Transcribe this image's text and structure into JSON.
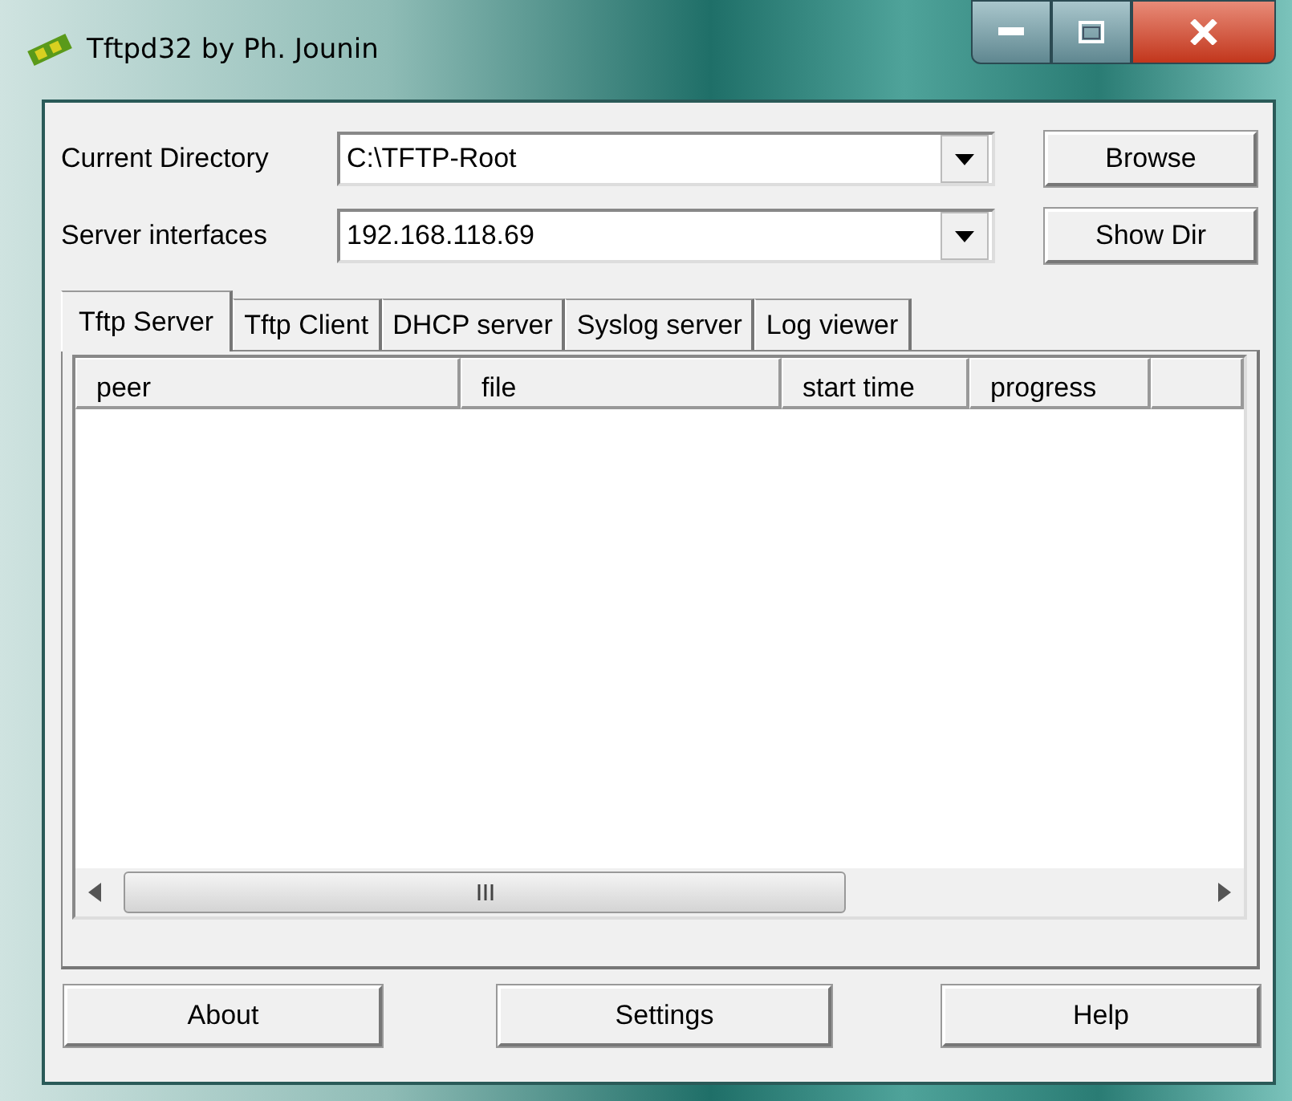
{
  "window": {
    "title": "Tftpd32 by Ph. Jounin"
  },
  "fields": [
    {
      "label": "Current Directory",
      "value": "C:\\TFTP-Root",
      "button": "Browse"
    },
    {
      "label": "Server interfaces",
      "value": "192.168.118.69",
      "button": "Show Dir"
    }
  ],
  "tabs": [
    {
      "label": "Tftp Server",
      "selected": true
    },
    {
      "label": "Tftp Client",
      "selected": false
    },
    {
      "label": "DHCP server",
      "selected": false
    },
    {
      "label": "Syslog server",
      "selected": false
    },
    {
      "label": "Log viewer",
      "selected": false
    }
  ],
  "table": {
    "columns": [
      "peer",
      "file",
      "start time",
      "progress"
    ]
  },
  "buttons": [
    "About",
    "Settings",
    "Help"
  ]
}
